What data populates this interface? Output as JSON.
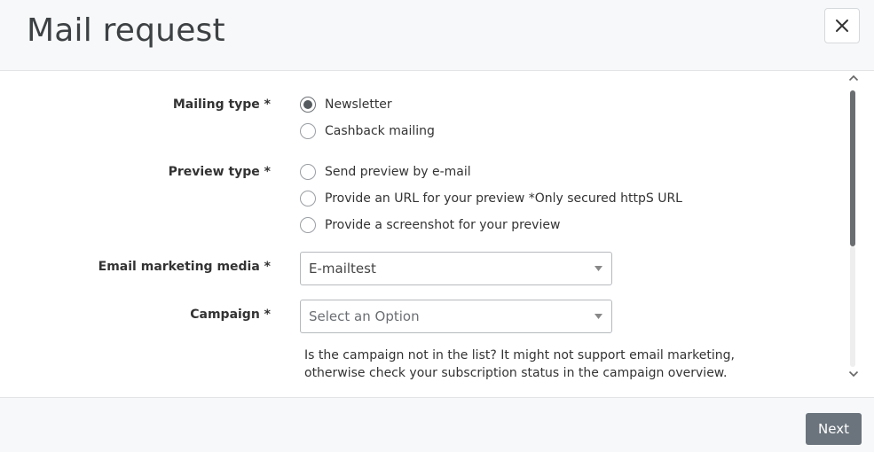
{
  "dialog": {
    "title": "Mail request",
    "close_icon": "close-icon"
  },
  "form": {
    "mailing_type": {
      "label": "Mailing type *",
      "options": [
        {
          "label": "Newsletter",
          "checked": true
        },
        {
          "label": "Cashback mailing",
          "checked": false
        }
      ]
    },
    "preview_type": {
      "label": "Preview type *",
      "options": [
        {
          "label": "Send preview by e-mail",
          "checked": false
        },
        {
          "label": "Provide an URL for your preview *Only secured httpS URL",
          "checked": false
        },
        {
          "label": "Provide a screenshot for your preview",
          "checked": false
        }
      ]
    },
    "email_marketing_media": {
      "label": "Email marketing media *",
      "value": "E-mailtest"
    },
    "campaign": {
      "label": "Campaign *",
      "placeholder": "Select an Option",
      "helper": "Is the campaign not in the list? It might not support email marketing, otherwise check your subscription status in the campaign overview."
    }
  },
  "footer": {
    "next_label": "Next"
  },
  "colors": {
    "header_bg": "#f7f8f9",
    "primary_button": "#6b747c",
    "text": "#333333"
  }
}
